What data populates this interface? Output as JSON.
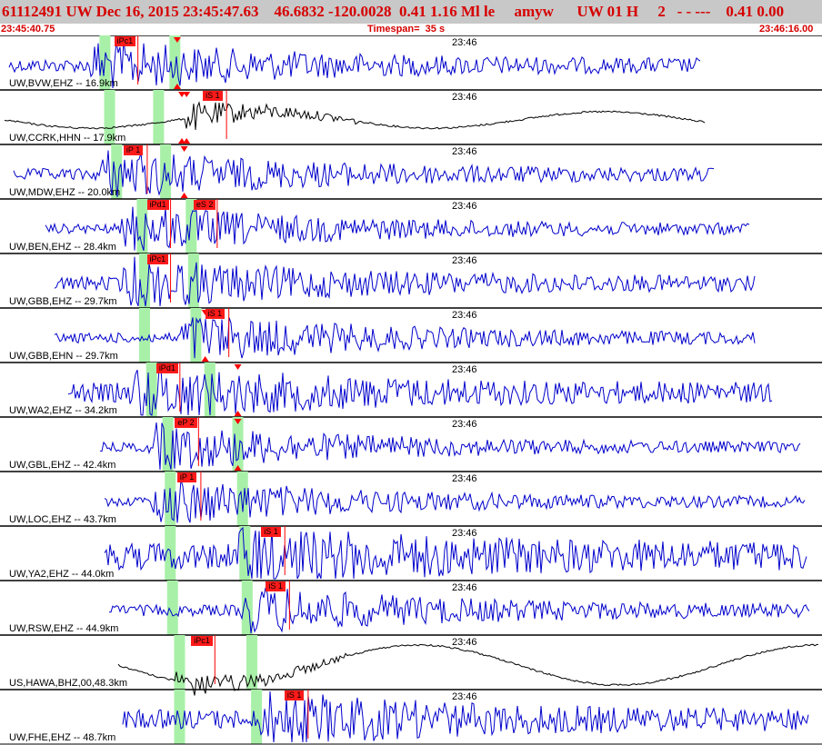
{
  "header": {
    "summary": "61112491 UW Dec 16, 2015 23:45:47.63    46.6832 -120.0028  0.41 1.16 Ml le     amyw      UW 01 H     2   - - ---    0.41 0.00",
    "start_time": "23:45:40.75",
    "timespan": "Timespan=  35 s",
    "end_time": "23:46:16.00"
  },
  "colors": {
    "header_background": "#c8c8c8",
    "header_text": "#d60000",
    "seismogram_short_period": "#0000cc",
    "seismogram_broadband": "#000000",
    "phase_window": "#a8f0a8",
    "pick_flag": "#ff1a1a",
    "separator": "#000000"
  },
  "timeline": {
    "start_seconds": 0,
    "end_seconds": 35.25
  },
  "traces": [
    {
      "label": "UW,BVW,EHZ -- 16.9km",
      "minute_label": "23:46",
      "color": "blue",
      "picks": [
        {
          "label": "iPc1",
          "t": 4.9
        }
      ],
      "windows": [
        4.5,
        7.5
      ],
      "markers": [
        7.6
      ]
    },
    {
      "label": "UW,CCRK,HHN -- 17.9km",
      "minute_label": "23:46",
      "color": "black",
      "picks": [
        {
          "label": "iS 1",
          "t": 8.7
        }
      ],
      "windows": [
        4.7,
        6.8
      ],
      "markers": [
        7.8,
        8.0
      ]
    },
    {
      "label": "UW,MDW,EHZ -- 20.0km",
      "minute_label": "23:46",
      "color": "blue",
      "picks": [
        {
          "label": "iP 1",
          "t": 5.3
        }
      ],
      "windows": [
        5.0,
        7.1
      ],
      "markers": [
        7.9
      ]
    },
    {
      "label": "UW,BEN,EHZ -- 28.4km",
      "minute_label": "23:46",
      "color": "blue",
      "picks": [
        {
          "label": "iPd1",
          "t": 6.3
        },
        {
          "label": "eS 2",
          "t": 8.3
        }
      ],
      "windows": [
        6.1,
        8.2
      ],
      "markers": []
    },
    {
      "label": "UW,GBB,EHZ -- 29.7km",
      "minute_label": "23:46",
      "color": "blue",
      "picks": [
        {
          "label": "iPc1",
          "t": 6.3
        }
      ],
      "windows": [
        6.2,
        8.3
      ],
      "markers": []
    },
    {
      "label": "UW,GBB,EHN -- 29.7km",
      "minute_label": "23:46",
      "color": "blue",
      "picks": [
        {
          "label": "iS 1",
          "t": 8.8
        }
      ],
      "windows": [
        6.2,
        8.4
      ],
      "markers": [
        8.8
      ]
    },
    {
      "label": "UW,WA2,EHZ -- 34.2km",
      "minute_label": "23:46",
      "color": "blue",
      "picks": [
        {
          "label": "iPd1",
          "t": 6.7
        }
      ],
      "windows": [
        6.5,
        9.0
      ],
      "markers": [
        10.2
      ]
    },
    {
      "label": "UW,GBL,EHZ -- 42.4km",
      "minute_label": "23:46",
      "color": "blue",
      "picks": [
        {
          "label": "eP 2",
          "t": 7.5
        }
      ],
      "windows": [
        7.2,
        10.2
      ],
      "markers": [
        10.2
      ]
    },
    {
      "label": "UW,LOC,EHZ -- 43.7km",
      "minute_label": "23:46",
      "color": "blue",
      "picks": [
        {
          "label": "iP 1",
          "t": 7.6
        }
      ],
      "windows": [
        7.3,
        10.4
      ],
      "markers": []
    },
    {
      "label": "UW,YA2,EHZ -- 44.0km",
      "minute_label": "23:46",
      "color": "blue",
      "picks": [
        {
          "label": "iS 1",
          "t": 11.2
        }
      ],
      "windows": [
        7.3,
        10.5
      ],
      "markers": []
    },
    {
      "label": "UW,RSW,EHZ -- 44.9km",
      "minute_label": "23:46",
      "color": "blue",
      "picks": [
        {
          "label": "iS 1",
          "t": 11.4
        }
      ],
      "windows": [
        7.4,
        10.6
      ],
      "markers": []
    },
    {
      "label": "US,HAWA,BHZ,00,48.3km",
      "minute_label": "23:46",
      "color": "black",
      "picks": [
        {
          "label": "iPc1",
          "t": 8.2
        }
      ],
      "windows": [
        7.7,
        10.8
      ],
      "markers": []
    },
    {
      "label": "UW,FHE,EHZ -- 48.7km",
      "minute_label": "23:46",
      "color": "blue",
      "picks": [
        {
          "label": "iS 1",
          "t": 12.2
        }
      ],
      "windows": [
        7.7,
        11.0
      ],
      "markers": []
    }
  ]
}
